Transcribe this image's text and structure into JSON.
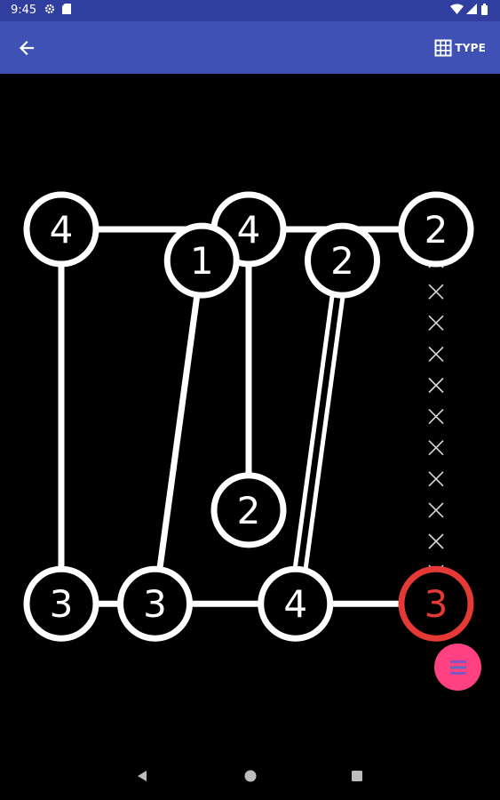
{
  "status_bar": {
    "time": "9:45",
    "icons": [
      "gear-icon",
      "sd-card-icon",
      "wifi-icon",
      "signal-icon",
      "battery-icon"
    ]
  },
  "app_bar": {
    "back_icon": "arrow-left-icon",
    "type_icon": "grid-icon",
    "type_label": "TYPE",
    "color": "#3f51b5",
    "status_color": "#303f9f"
  },
  "board": {
    "islands": [
      {
        "id": "a",
        "row": 0,
        "col": 0,
        "value": "4",
        "selected": false
      },
      {
        "id": "b",
        "row": 0,
        "col": 4,
        "value": "4",
        "selected": false
      },
      {
        "id": "c",
        "row": 0,
        "col": 8,
        "value": "2",
        "selected": false
      },
      {
        "id": "d",
        "row": 1,
        "col": 3,
        "value": "1",
        "selected": false
      },
      {
        "id": "e",
        "row": 1,
        "col": 6,
        "value": "2",
        "selected": false
      },
      {
        "id": "f",
        "row": 9,
        "col": 4,
        "value": "2",
        "selected": false
      },
      {
        "id": "g",
        "row": 12,
        "col": 0,
        "value": "3",
        "selected": false
      },
      {
        "id": "h",
        "row": 12,
        "col": 2,
        "value": "3",
        "selected": false
      },
      {
        "id": "i",
        "row": 12,
        "col": 5,
        "value": "4",
        "selected": false
      },
      {
        "id": "j",
        "row": 12,
        "col": 8,
        "value": "3",
        "selected": true
      }
    ],
    "bridges": [
      {
        "from": "a",
        "to": "b",
        "count": 1
      },
      {
        "from": "b",
        "to": "c",
        "count": 1
      },
      {
        "from": "a",
        "to": "g",
        "count": 1
      },
      {
        "from": "d",
        "to": "h",
        "count": 1
      },
      {
        "from": "b",
        "to": "f",
        "count": 1
      },
      {
        "from": "e",
        "to": "i",
        "count": 2
      },
      {
        "from": "g",
        "to": "h",
        "count": 1
      },
      {
        "from": "h",
        "to": "i",
        "count": 1
      },
      {
        "from": "i",
        "to": "j",
        "count": 1
      }
    ],
    "blocked": {
      "col": 8,
      "rows": [
        1,
        2,
        3,
        4,
        5,
        6,
        7,
        8,
        9,
        10,
        11
      ]
    },
    "colors": {
      "island": "#ffffff",
      "selected": "#e53935",
      "blocked": "#d9d9d9",
      "background": "#000000"
    }
  },
  "fab": {
    "icon": "menu-stack-icon",
    "color": "#ff4081"
  },
  "nav_bar": {
    "icons": [
      "back-triangle-icon",
      "home-circle-icon",
      "recents-square-icon"
    ]
  }
}
